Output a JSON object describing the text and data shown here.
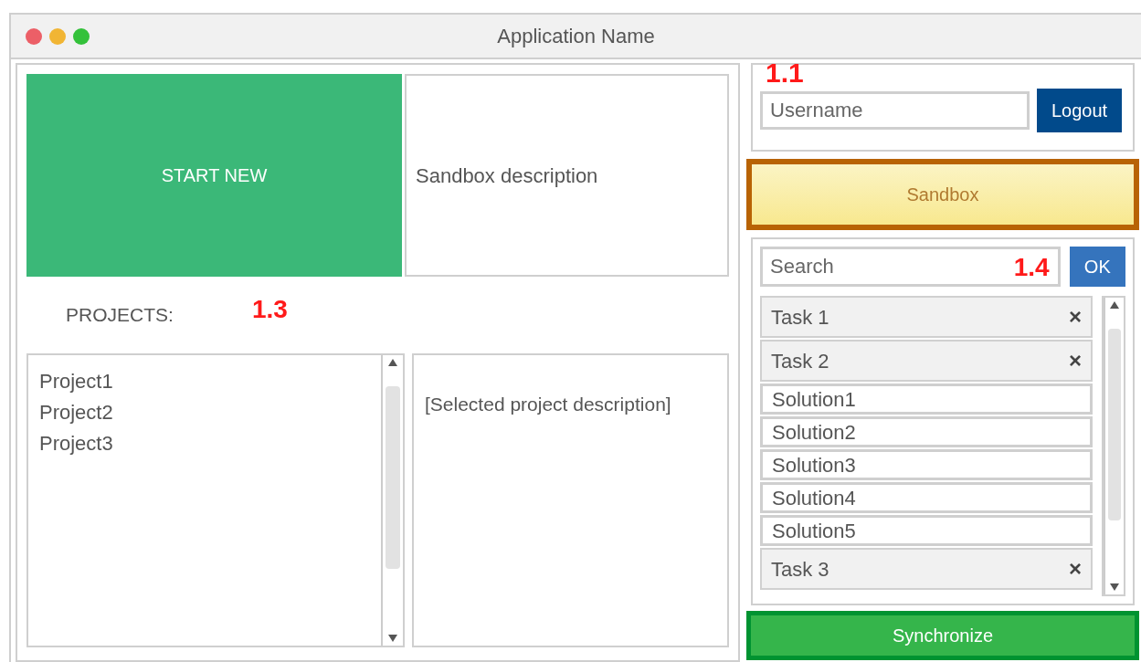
{
  "window": {
    "title": "Application Name"
  },
  "start_button": {
    "label": "START NEW"
  },
  "sandbox_description": "Sandbox description",
  "projects": {
    "label": "PROJECTS:",
    "annotation": "1.3",
    "items": [
      "Project1",
      "Project2",
      "Project3"
    ],
    "description": "[Selected project description]"
  },
  "user": {
    "annotation": "1.1",
    "placeholder": "Username",
    "logout": "Logout"
  },
  "sandbox_button": {
    "label": "Sandbox"
  },
  "search": {
    "placeholder": "Search",
    "annotation": "1.4",
    "button": "OK"
  },
  "tasks": [
    {
      "kind": "task",
      "label": "Task 1",
      "remove": "×"
    },
    {
      "kind": "task",
      "label": "Task 2",
      "remove": "×"
    },
    {
      "kind": "solution",
      "label": "Solution1"
    },
    {
      "kind": "solution",
      "label": "Solution2"
    },
    {
      "kind": "solution",
      "label": "Solution3"
    },
    {
      "kind": "solution",
      "label": "Solution4"
    },
    {
      "kind": "solution",
      "label": "Solution5"
    },
    {
      "kind": "task",
      "label": "Task 3",
      "remove": "×"
    }
  ],
  "sync_button": {
    "label": "Synchronize"
  }
}
